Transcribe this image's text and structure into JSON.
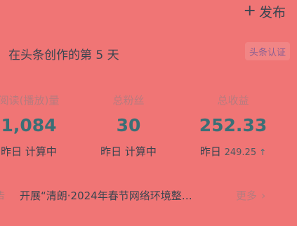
{
  "header": {
    "publish_icon": "plus-icon",
    "publish_plus": "+",
    "publish_label": "发布"
  },
  "creator": {
    "days_text": "在头条创作的第 5 天",
    "badge_label": "头条认证"
  },
  "stats": [
    {
      "label": "阅读(播放)量",
      "value": "1,084",
      "sub": "昨日 计算中"
    },
    {
      "label": "总粉丝",
      "value": "30",
      "sub": "昨日 计算中"
    },
    {
      "label": "总收益",
      "value": "252.33",
      "sub_prefix": "昨日",
      "sub_value": "249.25",
      "sub_icon": "up-arrow-icon",
      "sub_arrow": "↑"
    }
  ],
  "announcement": {
    "icon_text": "告",
    "text": "开展“清朗·2024年春节网络环境整…",
    "more_label": "更多",
    "more_chevron": "›"
  },
  "colors": {
    "background": "#f07575",
    "value": "#3b6f76",
    "label": "#b77b7e",
    "text": "#3b4550"
  }
}
